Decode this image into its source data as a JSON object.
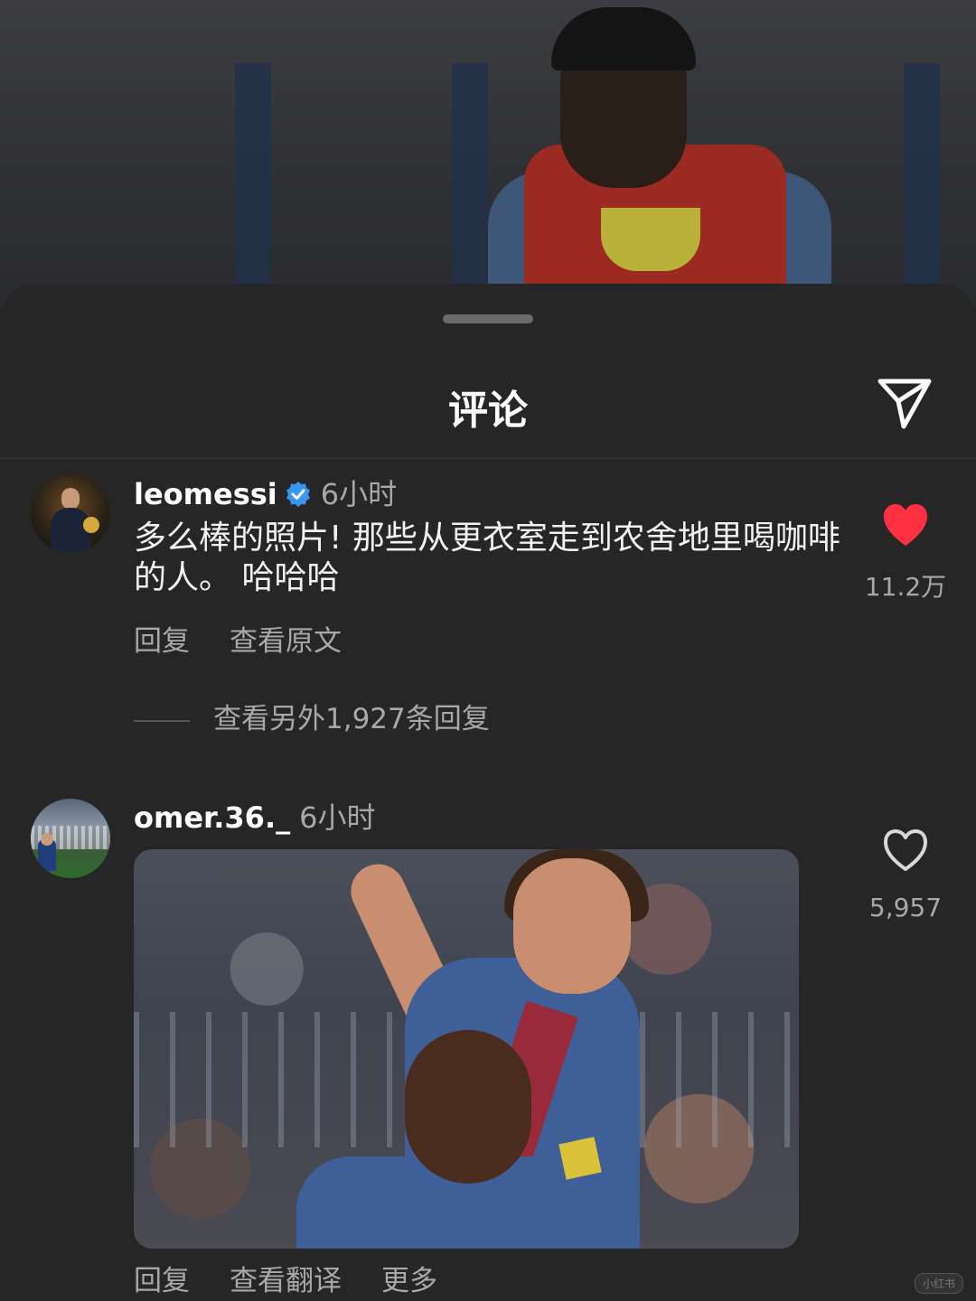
{
  "sheet": {
    "title": "评论"
  },
  "comments": [
    {
      "username": "leomessi",
      "verified": true,
      "time": "6小时",
      "text": "多么棒的照片! 那些从更衣室走到农舍地里喝咖啡的人。 哈哈哈",
      "actions": [
        "回复",
        "查看原文"
      ],
      "likes": "11.2万",
      "liked": true,
      "view_replies": "查看另外1,927条回复"
    },
    {
      "username": "omer.36._",
      "verified": false,
      "time": "6小时",
      "actions": [
        "回复",
        "查看翻译",
        "更多"
      ],
      "likes": "5,957",
      "liked": false,
      "has_gif": true
    }
  ],
  "colors": {
    "background": "#262626",
    "liked_heart": "#ff3040",
    "verified_badge": "#3897f0",
    "secondary_text": "#a8a8a8"
  },
  "icons": {
    "share": "send-icon",
    "like": "heart-icon",
    "verified": "verified-badge-icon"
  },
  "watermark": "小红书"
}
